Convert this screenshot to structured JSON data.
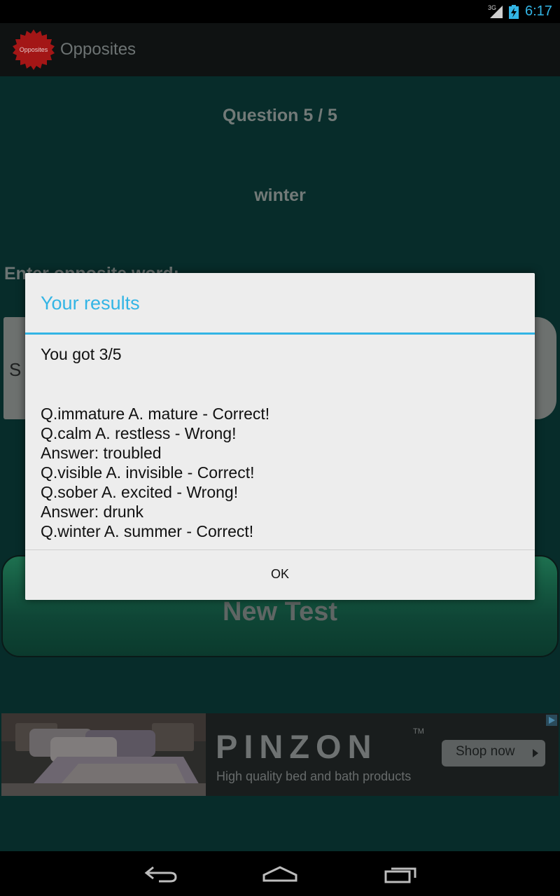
{
  "status_bar": {
    "network": "3G",
    "time": "6:17"
  },
  "action_bar": {
    "app_name": "Opposites",
    "logo_text": "Opposites"
  },
  "main": {
    "question_counter": "Question 5 / 5",
    "question_word": "winter",
    "enter_label": "Enter opposite word:",
    "answer_partial": "S",
    "new_test_label": "New Test"
  },
  "ad": {
    "brand": "PINZON",
    "trademark": "TM",
    "tagline": "High quality bed and bath products",
    "cta": "Shop now",
    "cta_icon": "play-arrow-icon"
  },
  "dialog": {
    "title": "Your results",
    "score_text": "You got 3/5",
    "result_lines": [
      "Q.immature A. mature - Correct!",
      "Q.calm A. restless - Wrong!",
      "Answer: troubled",
      "Q.visible A. invisible - Correct!",
      "Q.sober A. excited - Wrong!",
      "Answer: drunk",
      "Q.winter A. summer - Correct!"
    ],
    "ok_label": "OK"
  },
  "colors": {
    "accent": "#33b5e5",
    "logo": "#a31616",
    "dialog_bg": "#ededed"
  }
}
